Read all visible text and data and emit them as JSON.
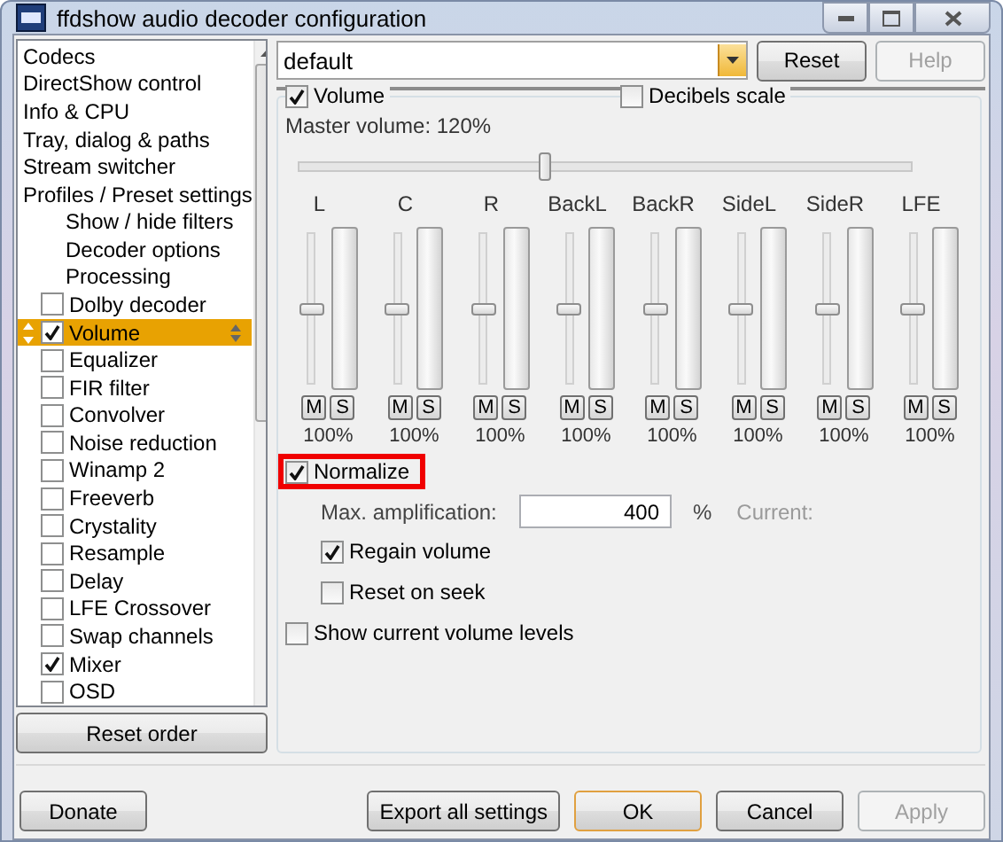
{
  "window": {
    "title": "ffdshow audio decoder configuration"
  },
  "sidebar": {
    "items": [
      {
        "kind": "page",
        "label": "Codecs"
      },
      {
        "kind": "page",
        "label": "DirectShow control"
      },
      {
        "kind": "page",
        "label": "Info & CPU"
      },
      {
        "kind": "page",
        "label": "Tray, dialog & paths"
      },
      {
        "kind": "page",
        "label": "Stream switcher"
      },
      {
        "kind": "page",
        "label": "Profiles / Preset settings",
        "children": [
          {
            "kind": "page",
            "label": "Show / hide filters"
          },
          {
            "kind": "page",
            "label": "Decoder options"
          },
          {
            "kind": "page",
            "label": "Processing"
          }
        ]
      },
      {
        "kind": "filter",
        "label": "Dolby decoder",
        "checked": false,
        "selected": false
      },
      {
        "kind": "filter",
        "label": "Volume",
        "checked": true,
        "selected": true
      },
      {
        "kind": "filter",
        "label": "Equalizer",
        "checked": false,
        "selected": false
      },
      {
        "kind": "filter",
        "label": "FIR filter",
        "checked": false,
        "selected": false
      },
      {
        "kind": "filter",
        "label": "Convolver",
        "checked": false,
        "selected": false
      },
      {
        "kind": "filter",
        "label": "Noise reduction",
        "checked": false,
        "selected": false
      },
      {
        "kind": "filter",
        "label": "Winamp 2",
        "checked": false,
        "selected": false
      },
      {
        "kind": "filter",
        "label": "Freeverb",
        "checked": false,
        "selected": false
      },
      {
        "kind": "filter",
        "label": "Crystality",
        "checked": false,
        "selected": false
      },
      {
        "kind": "filter",
        "label": "Resample",
        "checked": false,
        "selected": false
      },
      {
        "kind": "filter",
        "label": "Delay",
        "checked": false,
        "selected": false
      },
      {
        "kind": "filter",
        "label": "LFE Crossover",
        "checked": false,
        "selected": false
      },
      {
        "kind": "filter",
        "label": "Swap channels",
        "checked": false,
        "selected": false
      },
      {
        "kind": "filter",
        "label": "Mixer",
        "checked": true,
        "selected": false
      },
      {
        "kind": "filter",
        "label": "OSD",
        "checked": false,
        "selected": false
      }
    ],
    "reset_button": "Reset order"
  },
  "preset": {
    "value": "default",
    "reset_button": {
      "label": "Reset",
      "disabled": false
    },
    "help_button": {
      "label": "Help",
      "disabled": true
    }
  },
  "volume_panel": {
    "enable": {
      "label": "Volume",
      "checked": true
    },
    "decibels": {
      "label": "Decibels scale",
      "checked": false
    },
    "master_label": "Master volume: 120%",
    "master_slider": {
      "level": 0.4
    },
    "channels": [
      {
        "name": "L",
        "level": 0.5,
        "mute": "M",
        "solo": "S",
        "reading": "100%"
      },
      {
        "name": "C",
        "level": 0.5,
        "mute": "M",
        "solo": "S",
        "reading": "100%"
      },
      {
        "name": "R",
        "level": 0.5,
        "mute": "M",
        "solo": "S",
        "reading": "100%"
      },
      {
        "name": "BackL",
        "level": 0.5,
        "mute": "M",
        "solo": "S",
        "reading": "100%"
      },
      {
        "name": "BackR",
        "level": 0.5,
        "mute": "M",
        "solo": "S",
        "reading": "100%"
      },
      {
        "name": "SideL",
        "level": 0.5,
        "mute": "M",
        "solo": "S",
        "reading": "100%"
      },
      {
        "name": "SideR",
        "level": 0.5,
        "mute": "M",
        "solo": "S",
        "reading": "100%"
      },
      {
        "name": "LFE",
        "level": 0.5,
        "mute": "M",
        "solo": "S",
        "reading": "100%"
      }
    ],
    "normalize": {
      "label": "Normalize",
      "checked": true,
      "highlighted": true
    },
    "max_amplification": {
      "label": "Max. amplification:",
      "value": "400",
      "unit": "%",
      "current_label": "Current:"
    },
    "regain_volume": {
      "label": "Regain volume",
      "checked": true
    },
    "reset_on_seek": {
      "label": "Reset on seek",
      "checked": false
    },
    "show_levels": {
      "label": "Show current volume levels",
      "checked": false
    }
  },
  "donate_button": "Donate",
  "footer_buttons": [
    {
      "label": "Export all settings",
      "default": false,
      "disabled": false
    },
    {
      "label": "OK",
      "default": true,
      "disabled": false
    },
    {
      "label": "Cancel",
      "default": false,
      "disabled": false
    },
    {
      "label": "Apply",
      "default": false,
      "disabled": true
    }
  ]
}
